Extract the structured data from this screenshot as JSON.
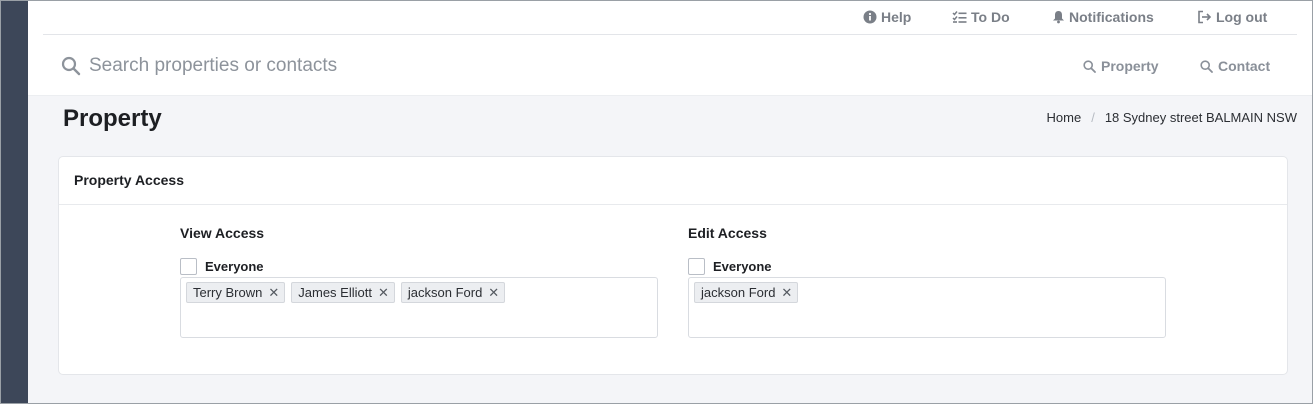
{
  "nav": {
    "help": "Help",
    "todo": "To Do",
    "notifications": "Notifications",
    "logout": "Log out"
  },
  "search": {
    "placeholder": "Search properties or contacts",
    "property_label": "Property",
    "contact_label": "Contact"
  },
  "page": {
    "title": "Property",
    "breadcrumb": [
      "Home",
      "18 Sydney street BALMAIN NSW"
    ]
  },
  "card": {
    "title": "Property Access",
    "view": {
      "title": "View Access",
      "everyone_label": "Everyone",
      "everyone_checked": false,
      "tags": [
        "Terry Brown",
        "James Elliott",
        "jackson Ford"
      ]
    },
    "edit": {
      "title": "Edit Access",
      "everyone_label": "Everyone",
      "everyone_checked": false,
      "tags": [
        "jackson Ford"
      ]
    }
  },
  "icons": {
    "help": "info-circle-icon",
    "todo": "checklist-icon",
    "notifications": "bell-icon",
    "logout": "sign-out-icon",
    "search": "search-icon",
    "tag_remove": "close-icon"
  },
  "colors": {
    "sidebar": "#3d4759",
    "muted_text": "#7a7f87",
    "page_bg": "#f4f5f8"
  }
}
